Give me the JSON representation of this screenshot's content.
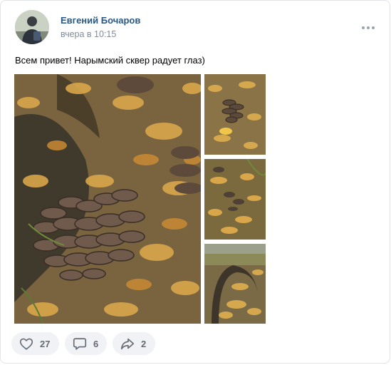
{
  "post": {
    "author": "Евгений Бочаров",
    "time": "вчера в 10:15",
    "text": "Всем привет! Нарымский сквер радует глаз)"
  },
  "actions": {
    "likes": "27",
    "comments": "6",
    "shares": "2"
  },
  "colors": {
    "author_link": "#2a5885",
    "meta_gray": "#818c99",
    "button_bg": "#f0f2f5",
    "icon_gray": "#656c75"
  },
  "icons": {
    "more": "more-dots-icon",
    "like": "heart-icon",
    "comment": "comment-icon",
    "share": "share-arrow-icon"
  }
}
